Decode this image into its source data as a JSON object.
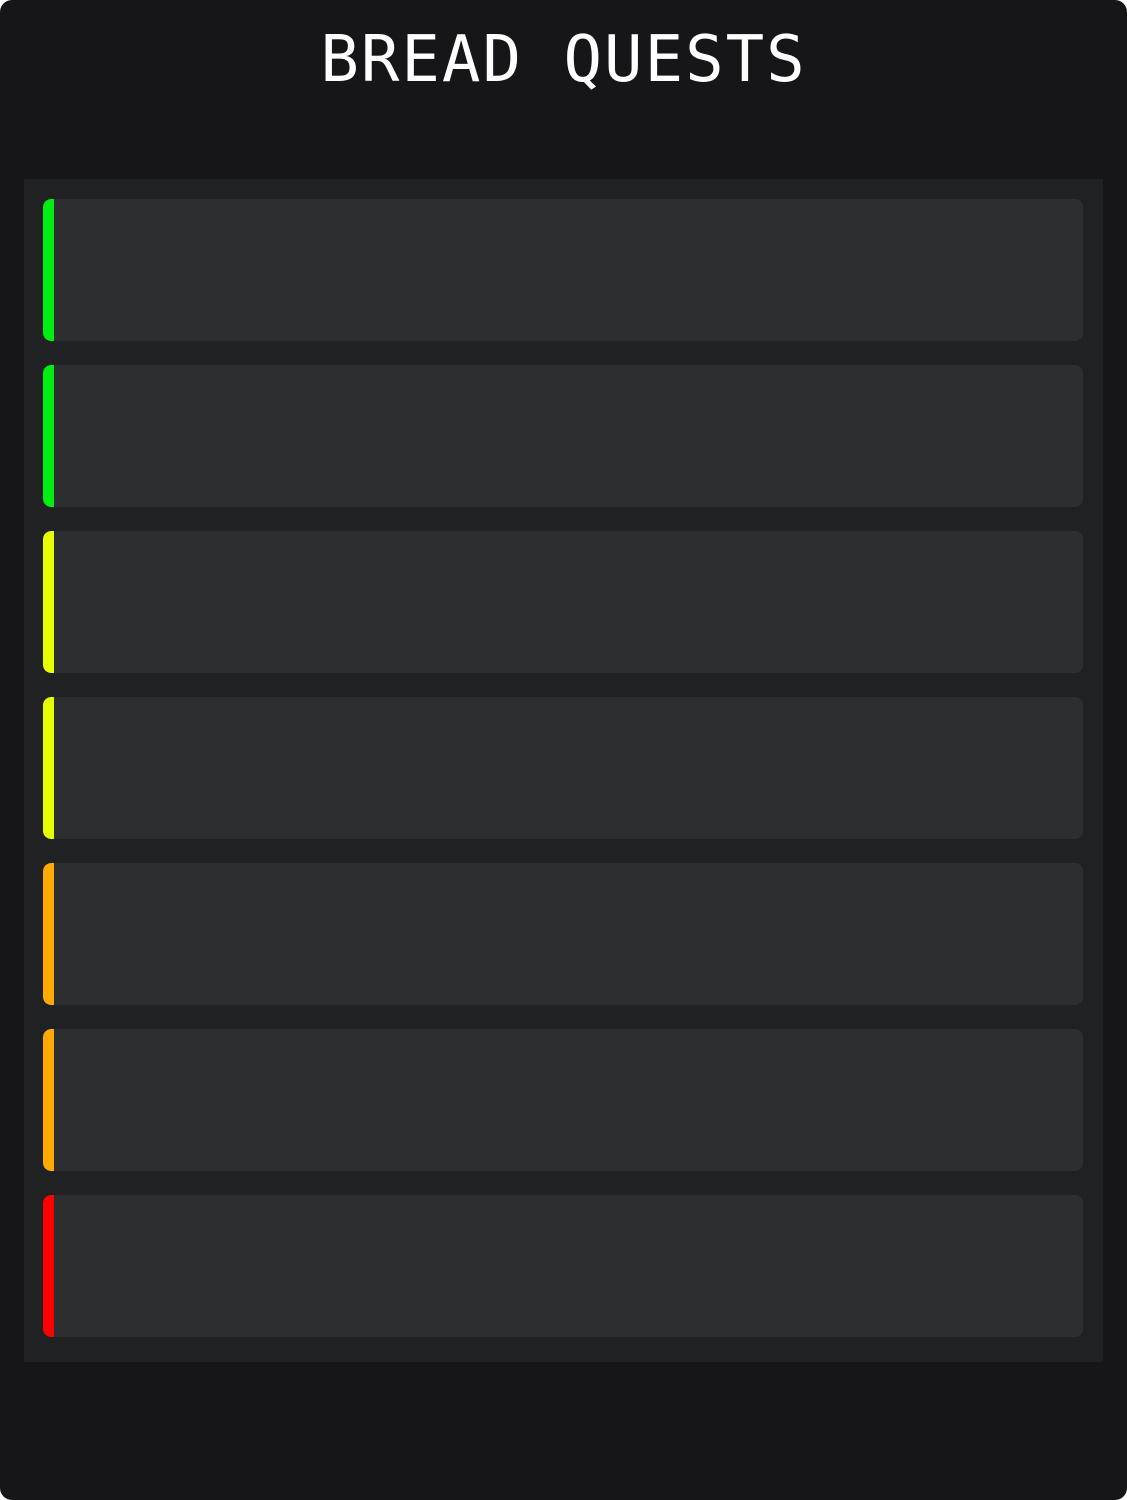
{
  "app": {
    "title": "BREAD QUESTS"
  },
  "quests": [
    {
      "label": "",
      "status_color": "#00ee11"
    },
    {
      "label": "",
      "status_color": "#00ee11"
    },
    {
      "label": "",
      "status_color": "#e6ff00"
    },
    {
      "label": "",
      "status_color": "#e6ff00"
    },
    {
      "label": "",
      "status_color": "#ffaa00"
    },
    {
      "label": "",
      "status_color": "#ffaa00"
    },
    {
      "label": "",
      "status_color": "#ff0000"
    }
  ],
  "colors": {
    "background": "#161618",
    "panel": "#202123",
    "card": "#2d2e30",
    "title_text": "#ffffff"
  }
}
